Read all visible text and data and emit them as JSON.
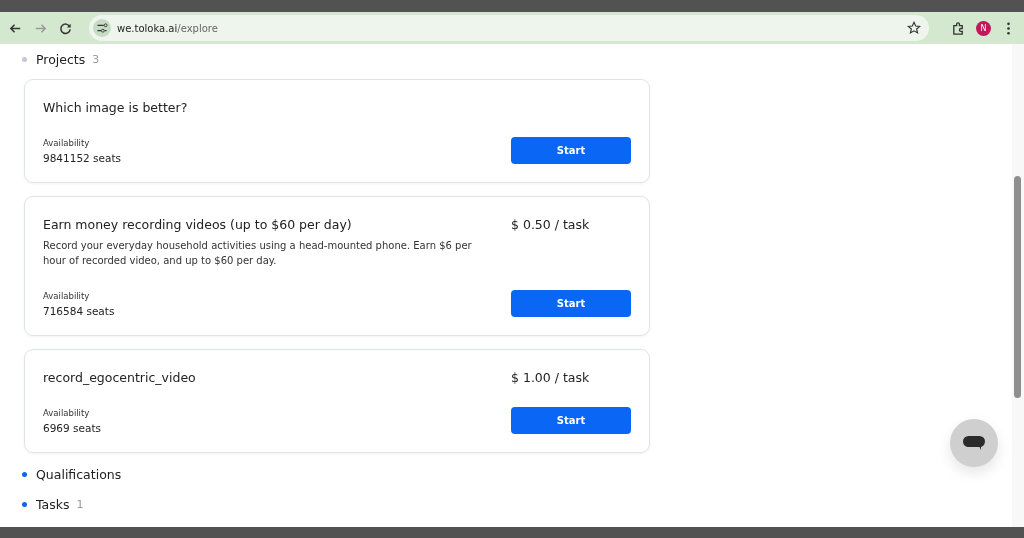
{
  "browser": {
    "url_host": "we.toloka.ai",
    "url_path": "/explore",
    "profile_initial": "N"
  },
  "sections": [
    {
      "title": "Projects",
      "count": "3",
      "color": "#c4c8d4",
      "projects": [
        {
          "title": "Which image is better?",
          "availability_label": "Availability",
          "seats": "9841152 seats",
          "button": "Start"
        },
        {
          "title": "Earn money recording videos (up to $60 per day)",
          "price": "$ 0.50 / task",
          "description": "Record your everyday household activities using a head-mounted phone. Earn $6 per hour of recorded video, and up to $60 per day.",
          "availability_label": "Availability",
          "seats": "716584 seats",
          "button": "Start"
        },
        {
          "title": "record_egocentric_video",
          "price": "$ 1.00 / task",
          "availability_label": "Availability",
          "seats": "6969 seats",
          "button": "Start"
        }
      ]
    },
    {
      "title": "Qualifications",
      "color": "#0a66f5"
    },
    {
      "title": "Tasks",
      "count": "1",
      "color": "#0a66f5"
    }
  ]
}
